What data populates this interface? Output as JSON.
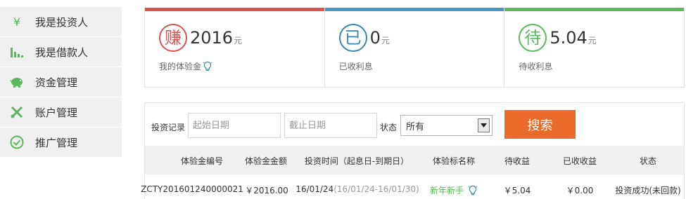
{
  "sidebar": {
    "items": [
      {
        "label": "我是投资人",
        "icon": "yen-icon"
      },
      {
        "label": "我是借款人",
        "icon": "bar-chart-icon"
      },
      {
        "label": "资金管理",
        "icon": "piggy-bank-icon"
      },
      {
        "label": "账户管理",
        "icon": "tools-icon"
      },
      {
        "label": "推广管理",
        "icon": "check-circle-icon"
      }
    ],
    "icon_color": "#5cb85c",
    "yen_glyph": "¥"
  },
  "summary": {
    "cards": [
      {
        "glyph": "赚",
        "value": "2016",
        "unit": "元",
        "label": "我的体验金",
        "color": "#d9534f",
        "bar_color": "#d9534f"
      },
      {
        "glyph": "已",
        "value": "0",
        "unit": "元",
        "label": "已收利息",
        "color": "#3a87ad",
        "bar_color": "#4a95c1"
      },
      {
        "glyph": "待",
        "value": "5.04",
        "unit": "元",
        "label": "待收利息",
        "color": "#5cb85c",
        "bar_color": "#5cb85c"
      }
    ]
  },
  "search": {
    "records_label": "投资记录",
    "start_placeholder": "起始日期",
    "end_placeholder": "截止日期",
    "status_label": "状态",
    "status_value": "所有",
    "button_label": "搜索",
    "button_color": "#e96a2a"
  },
  "table": {
    "headers": [
      "体验金编号",
      "体验金金额",
      "投资时间（起息日-到期日）",
      "体验标名称",
      "待收益",
      "已收收益",
      "状态"
    ],
    "rows": [
      {
        "id": "ZCTY20160124000002​1",
        "amount": "￥2016.00",
        "date": "16/01/24",
        "period": "(16/01/24-16/01/30)",
        "name": "新年新手",
        "pending": "￥5.04",
        "received": "￥0.00",
        "status": "投资成功(未回款)"
      }
    ]
  }
}
